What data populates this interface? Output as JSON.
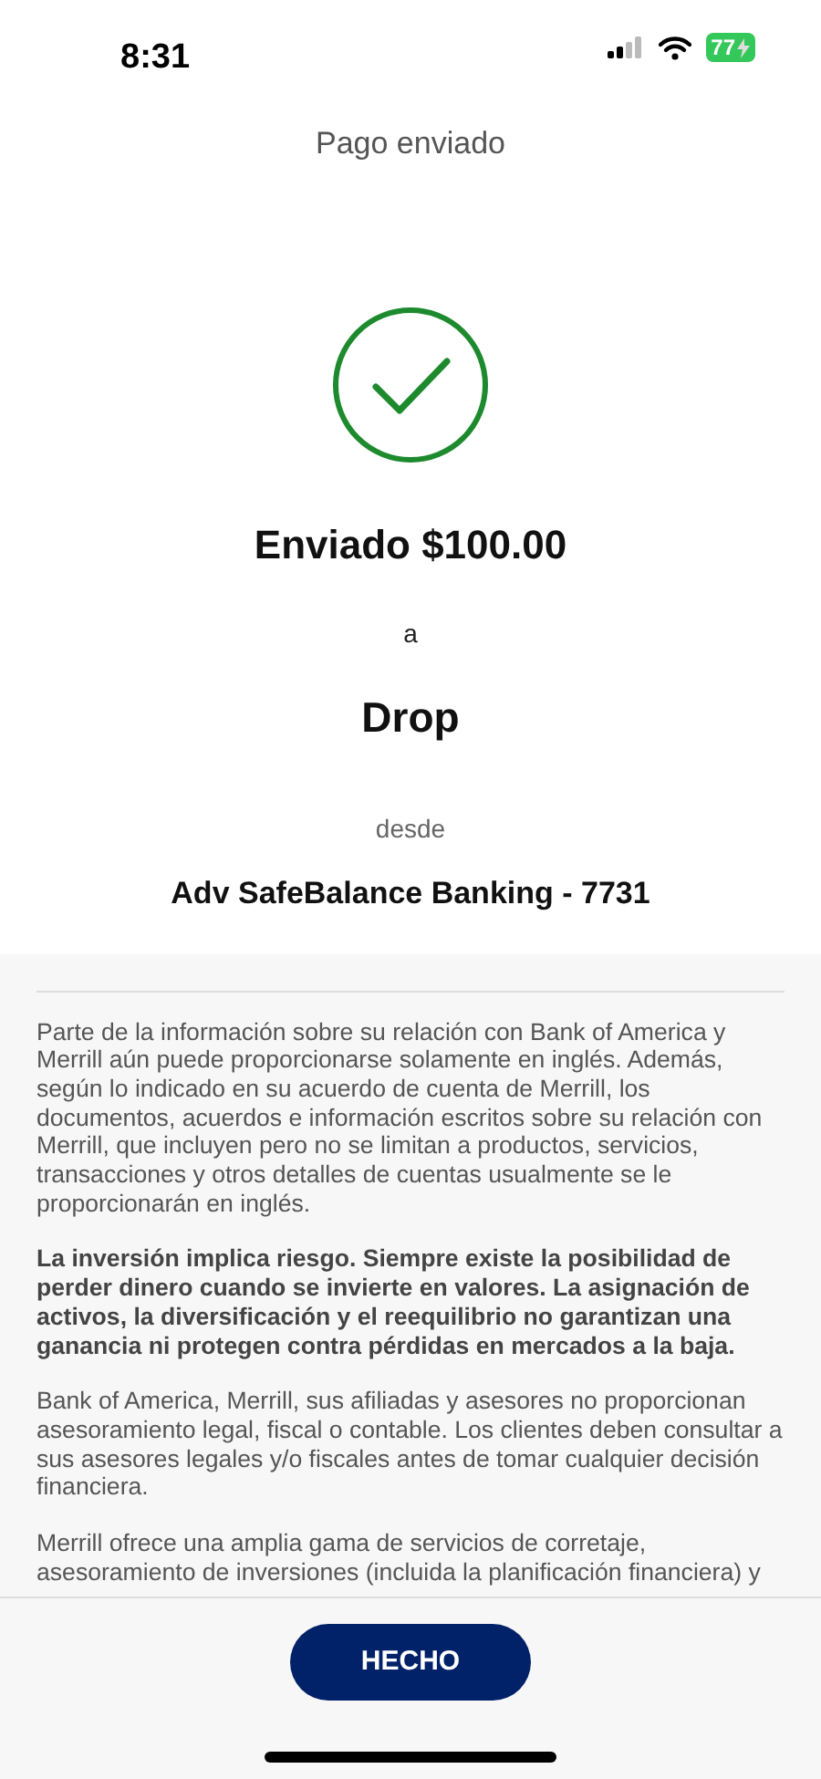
{
  "status_bar": {
    "time": "8:31",
    "battery": "77",
    "charging": true
  },
  "header": {
    "title": "Pago enviado"
  },
  "confirmation": {
    "success": true,
    "amount_line": "Enviado $100.00",
    "connector": "a",
    "recipient": "Drop",
    "from_label": "desde",
    "account": "Adv SafeBalance Banking - 7731"
  },
  "disclosures": [
    {
      "kind": "normal",
      "text": "Parte de la información sobre su relación con Bank of America y Merrill aún puede proporcionarse solamente en inglés. Además, según lo indicado en su acuerdo de cuenta de Merrill, los documentos, acuerdos e información escritos sobre su relación con Merrill, que incluyen pero no se limitan a productos, servicios, transacciones y otros detalles de cuentas usualmente se le proporcionarán en inglés."
    },
    {
      "kind": "bold",
      "text": "La inversión implica riesgo. Siempre existe la posibilidad de perder dinero cuando se invierte en valores. La asignación de activos, la diversificación y el reequilibrio no garantizan una ganancia ni protegen contra pérdidas en mercados a la baja."
    },
    {
      "kind": "normal",
      "text": "Bank of America, Merrill, sus afiliadas y asesores no proporcionan asesoramiento legal, fiscal o contable. Los clientes deben consultar a sus asesores legales y/o fiscales antes de tomar cualquier decisión financiera."
    },
    {
      "kind": "normal",
      "text": "Merrill ofrece una amplia gama de servicios de corretaje, asesoramiento de inversiones (incluida la planificación financiera) y"
    }
  ],
  "footer": {
    "button": "HECHO"
  }
}
